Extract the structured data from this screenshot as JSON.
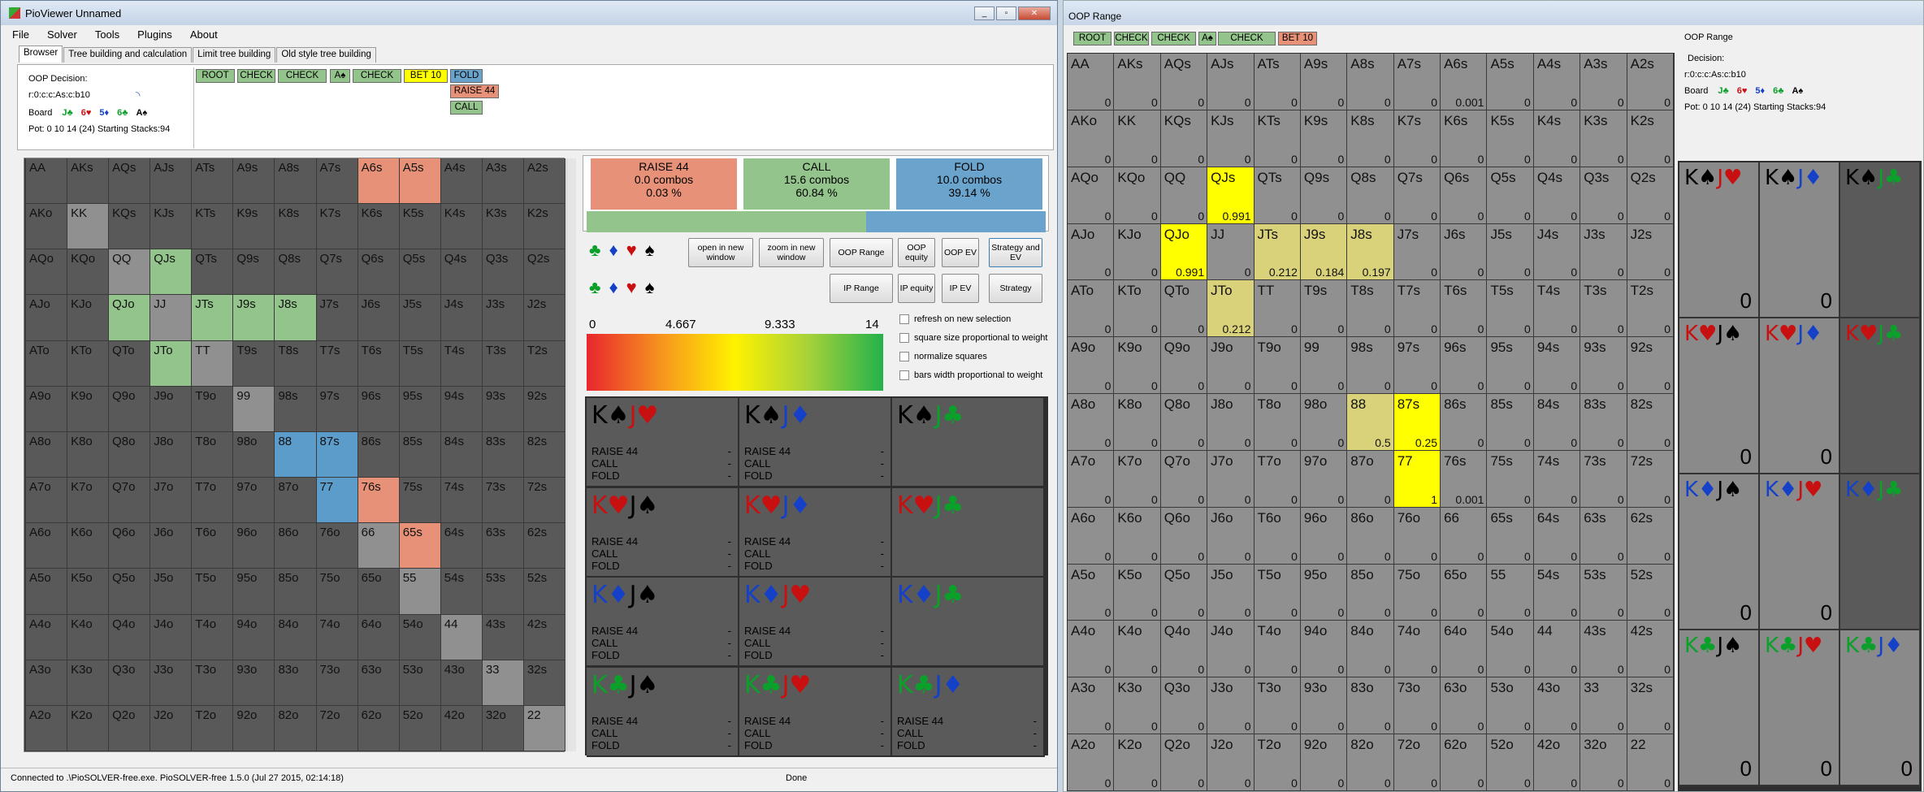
{
  "window_main": {
    "title": "PioViewer Unnamed",
    "menu": [
      "File",
      "Solver",
      "Tools",
      "Plugins",
      "About"
    ],
    "tabs": [
      "Browser",
      "Tree building and calculation",
      "Limit tree building",
      "Old style tree building"
    ],
    "decision_label": "OOP Decision:",
    "path": "r:0:c:c:As:c:b10",
    "board_label": "Board",
    "board": [
      {
        "t": "J♣",
        "s": "c"
      },
      {
        "t": "6♥",
        "s": "h"
      },
      {
        "t": "5♦",
        "s": "d"
      },
      {
        "t": "6♣",
        "s": "c"
      },
      {
        "t": "A♠",
        "s": "s"
      }
    ],
    "pot": "Pot: 0 10 14 (24) Starting Stacks:94",
    "tree_nodes": [
      "ROOT",
      "CHECK",
      "CHECK",
      "A♠",
      "CHECK",
      "BET 10",
      "FOLD"
    ],
    "tree_children": [
      "RAISE 44",
      "CALL"
    ],
    "actions": [
      {
        "name": "RAISE 44",
        "combos": "0.0 combos",
        "pct": "0.03 %",
        "color": "#e79278"
      },
      {
        "name": "CALL",
        "combos": "15.6 combos",
        "pct": "60.84 %",
        "color": "#93c48b"
      },
      {
        "name": "FOLD",
        "combos": "10.0 combos",
        "pct": "39.14 %",
        "color": "#6aa3cc"
      }
    ],
    "buttons": {
      "open_new": "open in new window",
      "zoom_new": "zoom in new window",
      "oop_range": "OOP Range",
      "oop_equity": "OOP equity",
      "oop_ev": "OOP EV",
      "strat_ev": "Strategy and EV",
      "ip_range": "IP Range",
      "ip_equity": "IP equity",
      "ip_ev": "IP EV",
      "strategy": "Strategy"
    },
    "scale": [
      "0",
      "4.667",
      "9.333",
      "14"
    ],
    "checkboxes": [
      "refresh on new selection",
      "square size proportional to weight",
      "normalize squares",
      "bars width proportional to weight"
    ],
    "status": "Connected to .\\PioSOLVER-free.exe. PioSOLVER-free 1.5.0 (Jul 27 2015, 02:14:18)",
    "status_right": "Done",
    "lines": [
      "RAISE 44",
      "CALL",
      "FOLD"
    ],
    "dash": "-"
  },
  "window_range": {
    "title": "OOP Range",
    "nodes": [
      "ROOT",
      "CHECK",
      "CHECK",
      "A♠",
      "CHECK",
      "BET 10"
    ],
    "side_title": "OOP Range",
    "decision_label": "Decision:",
    "path": "r:0:c:c:As:c:b10",
    "board_label": "Board",
    "pot": "Pot: 0 10 14 (24) Starting Stacks:94",
    "zero": "0"
  },
  "hands": [
    "AA",
    "AKs",
    "AQs",
    "AJs",
    "ATs",
    "A9s",
    "A8s",
    "A7s",
    "A6s",
    "A5s",
    "A4s",
    "A3s",
    "A2s",
    "AKo",
    "KK",
    "KQs",
    "KJs",
    "KTs",
    "K9s",
    "K8s",
    "K7s",
    "K6s",
    "K5s",
    "K4s",
    "K3s",
    "K2s",
    "AQo",
    "KQo",
    "QQ",
    "QJs",
    "QTs",
    "Q9s",
    "Q8s",
    "Q7s",
    "Q6s",
    "Q5s",
    "Q4s",
    "Q3s",
    "Q2s",
    "AJo",
    "KJo",
    "QJo",
    "JJ",
    "JTs",
    "J9s",
    "J8s",
    "J7s",
    "J6s",
    "J5s",
    "J4s",
    "J3s",
    "J2s",
    "ATo",
    "KTo",
    "QTo",
    "JTo",
    "TT",
    "T9s",
    "T8s",
    "T7s",
    "T6s",
    "T5s",
    "T4s",
    "T3s",
    "T2s",
    "A9o",
    "K9o",
    "Q9o",
    "J9o",
    "T9o",
    "99",
    "98s",
    "97s",
    "96s",
    "95s",
    "94s",
    "93s",
    "92s",
    "A8o",
    "K8o",
    "Q8o",
    "J8o",
    "T8o",
    "98o",
    "88",
    "87s",
    "86s",
    "85s",
    "84s",
    "83s",
    "82s",
    "A7o",
    "K7o",
    "Q7o",
    "J7o",
    "T7o",
    "97o",
    "87o",
    "77",
    "76s",
    "75s",
    "74s",
    "73s",
    "72s",
    "A6o",
    "K6o",
    "Q6o",
    "J6o",
    "T6o",
    "96o",
    "86o",
    "76o",
    "66",
    "65s",
    "64s",
    "63s",
    "62s",
    "A5o",
    "K5o",
    "Q5o",
    "J5o",
    "T5o",
    "95o",
    "85o",
    "75o",
    "65o",
    "55",
    "54s",
    "53s",
    "52s",
    "A4o",
    "K4o",
    "Q4o",
    "J4o",
    "T4o",
    "94o",
    "84o",
    "74o",
    "64o",
    "54o",
    "44",
    "43s",
    "42s",
    "A3o",
    "K3o",
    "Q3o",
    "J3o",
    "T3o",
    "93o",
    "83o",
    "73o",
    "63o",
    "53o",
    "43o",
    "33",
    "32s",
    "A2o",
    "K2o",
    "Q2o",
    "J2o",
    "T2o",
    "92o",
    "82o",
    "72o",
    "62o",
    "52o",
    "42o",
    "32o",
    "22"
  ],
  "main_colors": {
    "A6s": "red",
    "A5s": "red",
    "KK": "gray",
    "QQ": "gray",
    "QJs": "grn",
    "QJo": "grn",
    "JJ": "gray",
    "JTs": "grn",
    "J9s": "grn",
    "J8s": "grn",
    "JTo": "grn",
    "TT": "gray",
    "99": "gray",
    "88": "blu",
    "87s": "blu",
    "77": "blu",
    "76s": "red",
    "66": "gray",
    "65s": "red",
    "55": "gray",
    "44": "gray",
    "33": "gray",
    "22": "gray"
  },
  "range_values": {
    "A6s": "0.001",
    "QJs": "0.991",
    "QJo": "0.991",
    "JTs": "0.212",
    "J9s": "0.184",
    "J8s": "0.197",
    "JTo": "0.212",
    "88": "0.5",
    "87s": "0.25",
    "77": "1",
    "76s": "0.001"
  },
  "range_colors": {
    "QJs": "yel",
    "QJo": "yel",
    "JTs": "ylt",
    "J9s": "ylt",
    "J8s": "ylt",
    "JTo": "ylt",
    "88": "ylt",
    "87s": "yel",
    "77": "yel"
  },
  "combos": [
    [
      {
        "a": "K♠",
        "as": "s",
        "b": "J♥",
        "bs": "h",
        "lines": true
      },
      {
        "a": "K♠",
        "as": "s",
        "b": "J♦",
        "bs": "d",
        "lines": true
      },
      {
        "a": "K♠",
        "as": "s",
        "b": "J♣",
        "bs": "c",
        "lines": false
      }
    ],
    [
      {
        "a": "K♥",
        "as": "h",
        "b": "J♠",
        "bs": "s",
        "lines": true
      },
      {
        "a": "K♥",
        "as": "h",
        "b": "J♦",
        "bs": "d",
        "lines": true
      },
      {
        "a": "K♥",
        "as": "h",
        "b": "J♣",
        "bs": "c",
        "lines": false
      }
    ],
    [
      {
        "a": "K♦",
        "as": "d",
        "b": "J♠",
        "bs": "s",
        "lines": true
      },
      {
        "a": "K♦",
        "as": "d",
        "b": "J♥",
        "bs": "h",
        "lines": true
      },
      {
        "a": "K♦",
        "as": "d",
        "b": "J♣",
        "bs": "c",
        "lines": false
      }
    ],
    [
      {
        "a": "K♣",
        "as": "c",
        "b": "J♠",
        "bs": "s",
        "lines": true
      },
      {
        "a": "K♣",
        "as": "c",
        "b": "J♥",
        "bs": "h",
        "lines": true
      },
      {
        "a": "K♣",
        "as": "c",
        "b": "J♦",
        "bs": "d",
        "lines": true
      }
    ]
  ],
  "suit_row1": [
    {
      "t": "♣",
      "s": "c"
    },
    {
      "t": "♦",
      "s": "d"
    },
    {
      "t": "♥",
      "s": "h"
    },
    {
      "t": "♠",
      "s": "s"
    }
  ],
  "suit_row2": [
    {
      "t": "♣",
      "s": "c"
    },
    {
      "t": "♦",
      "s": "d"
    },
    {
      "t": "♥",
      "s": "h"
    },
    {
      "t": "♠",
      "s": "s"
    }
  ]
}
